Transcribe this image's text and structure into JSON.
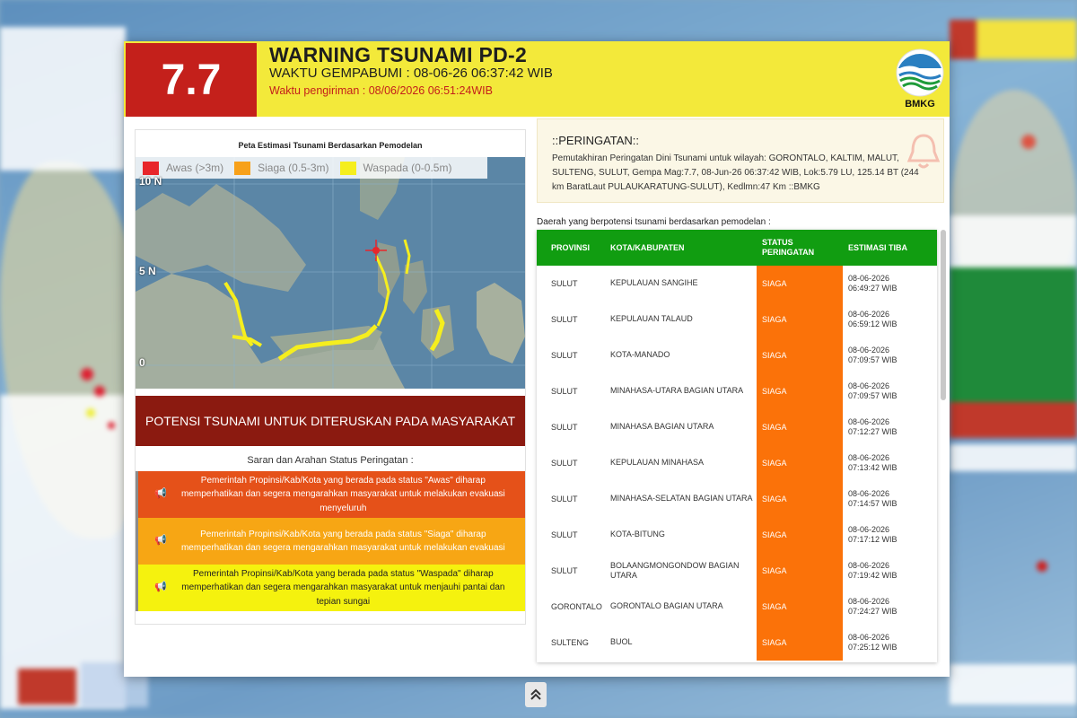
{
  "header": {
    "magnitude": "7.7",
    "title": "WARNING TSUNAMI PD-2",
    "quake_time": "WAKTU GEMPABUMI : 08-06-26 06:37:42 WIB",
    "sent_time": "Waktu pengiriman : 08/06/2026 06:51:24WIB",
    "logo_text": "BMKG"
  },
  "map": {
    "title": "Peta Estimasi Tsunami Berdasarkan Pemodelan",
    "legend": [
      {
        "label": "Awas (>3m)",
        "color": "#e8262b"
      },
      {
        "label": "Siaga (0.5-3m)",
        "color": "#f7a11a"
      },
      {
        "label": "Waspada (0-0.5m)",
        "color": "#f5ee1e"
      }
    ],
    "lat_labels": [
      "10 N",
      "5 N",
      "0"
    ]
  },
  "potensi_label": "POTENSI TSUNAMI UNTUK DITERUSKAN PADA MASYARAKAT",
  "saran_title": "Saran dan Arahan Status Peringatan :",
  "advice": [
    {
      "text": "Pemerintah Propinsi/Kab/Kota yang berada pada status \"Awas\" diharap memperhatikan dan segera mengarahkan masyarakat untuk melakukan evakuasi menyeluruh"
    },
    {
      "text": "Pemerintah Propinsi/Kab/Kota yang berada pada status \"Siaga\" diharap memperhatikan dan segera mengarahkan masyarakat untuk melakukan evakuasi"
    },
    {
      "text": "Pemerintah Propinsi/Kab/Kota yang berada pada status \"Waspada\" diharap memperhatikan dan segera mengarahkan masyarakat untuk menjauhi pantai dan tepian sungai"
    }
  ],
  "warning": {
    "title": "::PERINGATAN::",
    "body": "Pemutakhiran Peringatan Dini Tsunami untuk wilayah: GORONTALO, KALTIM, MALUT, SULTENG, SULUT, Gempa Mag:7.7, 08-Jun-26 06:37:42 WIB, Lok:5.79 LU, 125.14 BT (244 km BaratLaut PULAUKARATUNG-SULUT), Kedlmn:47 Km ::BMKG"
  },
  "daerah_label": "Daerah yang berpotensi tsunami berdasarkan pemodelan :",
  "table": {
    "headers": {
      "provinsi": "PROVINSI",
      "kota": "KOTA/KABUPATEN",
      "status": "STATUS PERINGATAN",
      "estimasi": "ESTIMASI TIBA"
    },
    "rows": [
      {
        "provinsi": "SULUT",
        "kota": "KEPULAUAN SANGIHE",
        "status": "SIAGA",
        "date": "08-06-2026",
        "time": "06:49:27 WIB"
      },
      {
        "provinsi": "SULUT",
        "kota": "KEPULAUAN TALAUD",
        "status": "SIAGA",
        "date": "08-06-2026",
        "time": "06:59:12 WIB"
      },
      {
        "provinsi": "SULUT",
        "kota": "KOTA-MANADO",
        "status": "SIAGA",
        "date": "08-06-2026",
        "time": "07:09:57 WIB"
      },
      {
        "provinsi": "SULUT",
        "kota": "MINAHASA-UTARA BAGIAN UTARA",
        "status": "SIAGA",
        "date": "08-06-2026",
        "time": "07:09:57 WIB"
      },
      {
        "provinsi": "SULUT",
        "kota": "MINAHASA BAGIAN UTARA",
        "status": "SIAGA",
        "date": "08-06-2026",
        "time": "07:12:27 WIB"
      },
      {
        "provinsi": "SULUT",
        "kota": "KEPULAUAN MINAHASA",
        "status": "SIAGA",
        "date": "08-06-2026",
        "time": "07:13:42 WIB"
      },
      {
        "provinsi": "SULUT",
        "kota": "MINAHASA-SELATAN BAGIAN UTARA",
        "status": "SIAGA",
        "date": "08-06-2026",
        "time": "07:14:57 WIB"
      },
      {
        "provinsi": "SULUT",
        "kota": "KOTA-BITUNG",
        "status": "SIAGA",
        "date": "08-06-2026",
        "time": "07:17:12 WIB"
      },
      {
        "provinsi": "SULUT",
        "kota": "BOLAANGMONGONDOW BAGIAN UTARA",
        "status": "SIAGA",
        "date": "08-06-2026",
        "time": "07:19:42 WIB"
      },
      {
        "provinsi": "GORONTALO",
        "kota": "GORONTALO BAGIAN UTARA",
        "status": "SIAGA",
        "date": "08-06-2026",
        "time": "07:24:27 WIB"
      },
      {
        "provinsi": "SULTENG",
        "kota": "BUOL",
        "status": "SIAGA",
        "date": "08-06-2026",
        "time": "07:25:12 WIB"
      }
    ]
  },
  "colors": {
    "magnitude_bg": "#c4201b",
    "header_bg": "#f3e93a",
    "table_header": "#119d11",
    "siaga": "#fb7209",
    "potensi_bg": "#8b1a10"
  }
}
